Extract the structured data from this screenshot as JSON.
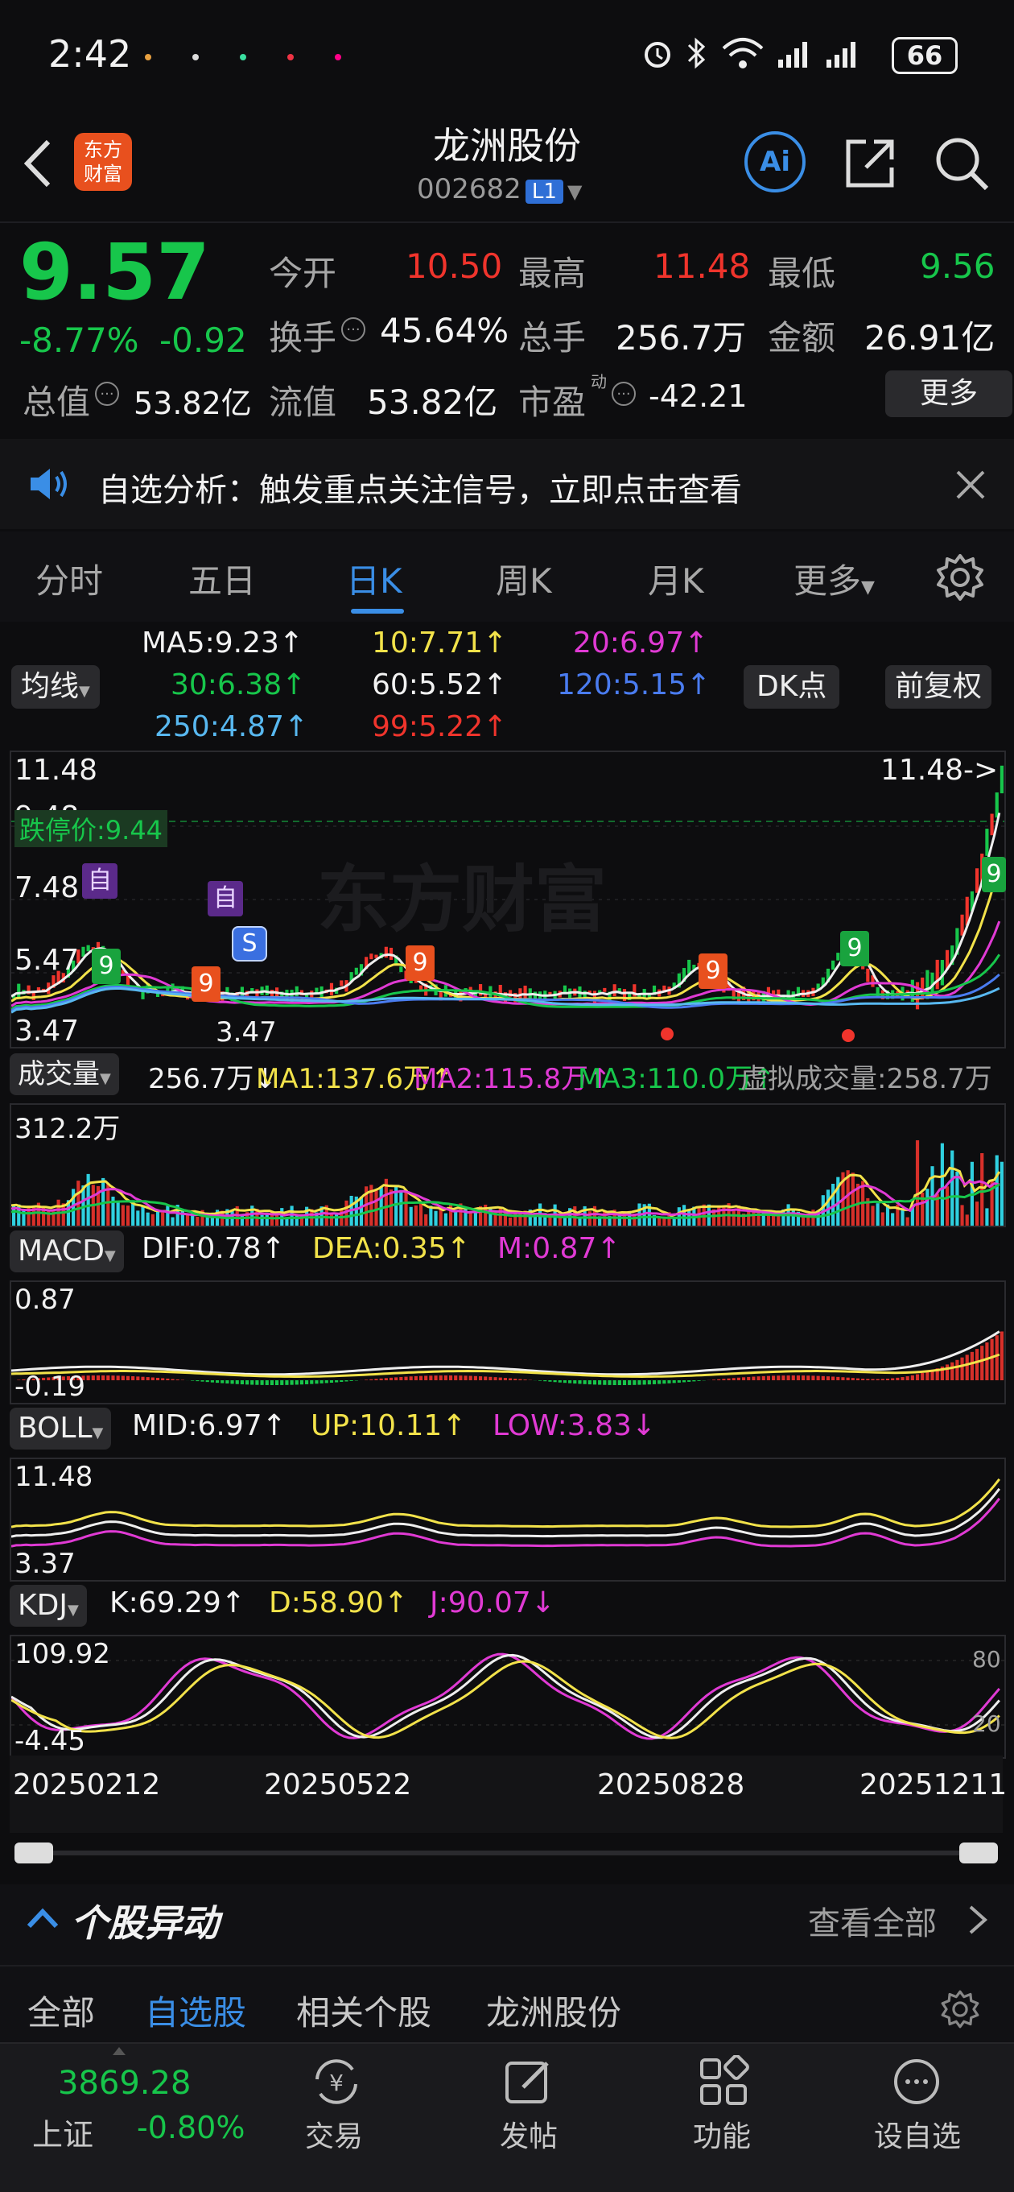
{
  "status": {
    "time": "2:42",
    "battery": "66"
  },
  "header": {
    "title": "龙洲股份",
    "code": "002682",
    "level": "L1",
    "ai_label": "Ai",
    "logo_text": "东方财富"
  },
  "quote": {
    "price": "9.57",
    "change_pct": "-8.77%",
    "change": "-0.92",
    "open_label": "今开",
    "open": "10.50",
    "high_label": "最高",
    "high": "11.48",
    "low_label": "最低",
    "low": "9.56",
    "turnover_label": "换手",
    "turnover": "45.64%",
    "volume_label": "总手",
    "volume": "256.7万",
    "amount_label": "金额",
    "amount": "26.91亿",
    "mktcap_label": "总值",
    "mktcap": "53.82亿",
    "float_label": "流值",
    "float": "53.82亿",
    "pe_label": "市盈",
    "pe_super": "动",
    "pe": "-42.21",
    "more": "更多"
  },
  "notice": {
    "text": "自选分析：触发重点关注信号，立即点击查看"
  },
  "tabs": [
    "分时",
    "五日",
    "日K",
    "周K",
    "月K",
    "更多"
  ],
  "ma": {
    "selector": "均线",
    "ma5": "MA5:9.23↑",
    "ma10": "10:7.71↑",
    "ma20": "20:6.97↑",
    "ma30": "30:6.38↑",
    "ma60": "60:5.52↑",
    "ma120": "120:5.15↑",
    "ma250": "250:4.87↑",
    "ma99": "99:5.22↑",
    "dk": "DK点",
    "adj": "前复权"
  },
  "kline": {
    "top": "11.48",
    "mid1": "9.48",
    "mid2": "7.48",
    "mid3": "5.47",
    "bottom": "3.47",
    "limit_down": "跌停价:9.44",
    "high_mark": "11.48->",
    "low_mark": "3.47",
    "watermark": "东方财富",
    "tag_zi": "自",
    "tag_s": "S",
    "num9": "9"
  },
  "volume": {
    "selector": "成交量",
    "vol": "256.7万↓",
    "ma1": "MA1:137.6万↑",
    "ma2": "MA2:115.8万↑",
    "ma3": "MA3:110.0万↑",
    "virtual": "虚拟成交量:258.7万",
    "max": "312.2万"
  },
  "macd": {
    "selector": "MACD",
    "dif": "DIF:0.78↑",
    "dea": "DEA:0.35↑",
    "m": "M:0.87↑",
    "top": "0.87",
    "bottom": "-0.19"
  },
  "boll": {
    "selector": "BOLL",
    "mid": "MID:6.97↑",
    "up": "UP:10.11↑",
    "low": "LOW:3.83↓",
    "top": "11.48",
    "bottom": "3.37"
  },
  "kdj": {
    "selector": "KDJ",
    "k": "K:69.29↑",
    "d": "D:58.90↑",
    "j": "J:90.07↓",
    "top": "109.92",
    "bottom": "-4.45",
    "l80": "80",
    "l20": "20"
  },
  "dates": [
    "20250212",
    "20250522",
    "20250828",
    "20251211"
  ],
  "section": {
    "title": "个股异动",
    "link": "查看全部"
  },
  "bottom_tabs": [
    "全部",
    "自选股",
    "相关个股",
    "龙洲股份"
  ],
  "index": {
    "value": "3869.28",
    "name": "上证",
    "pct": "-0.80%"
  },
  "nav": [
    "交易",
    "发帖",
    "功能",
    "设自选"
  ],
  "colors": {
    "up": "#f0342c",
    "down": "#17c64b",
    "accent": "#3a8ee6",
    "ma_yellow": "#f2e24a",
    "ma_magenta": "#e03ad4",
    "ma_blue": "#4a7cf0",
    "ma_cyan": "#58b8f0"
  }
}
